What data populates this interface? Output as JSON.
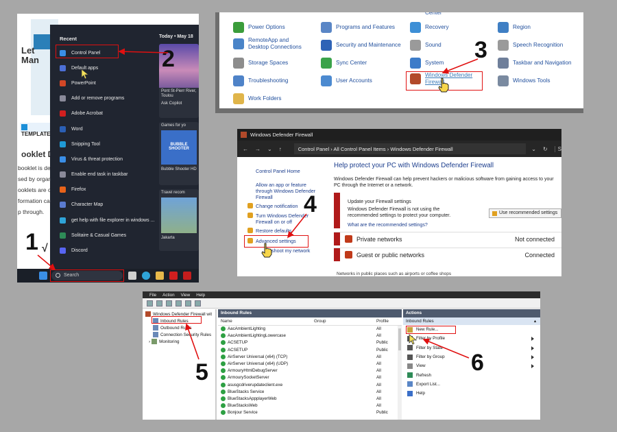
{
  "step_numbers": {
    "s1": "1",
    "s2": "2",
    "s3": "3",
    "s4": "4",
    "s5": "5",
    "s6": "6"
  },
  "start_menu": {
    "doc_title_1": "Let",
    "doc_title_2": "Man",
    "doc_badge": "TEMPLATE.",
    "doc_heading": "ooklet D",
    "doc_lines": [
      "booklet is det",
      "sed by organiz",
      "ooklets are or",
      "formation car",
      "p through."
    ],
    "doc_mark": "√",
    "recent_label": "Recent",
    "items": [
      {
        "label": "Control Panel",
        "icon": "control-panel-icon",
        "color": "#3a8ee6"
      },
      {
        "label": "Default apps",
        "icon": "default-apps-icon",
        "color": "#4c6fd6"
      },
      {
        "label": "PowerPoint",
        "icon": "powerpoint-icon",
        "color": "#d24726"
      },
      {
        "label": "Add or remove programs",
        "icon": "apps-icon",
        "color": "#8a8a9a"
      },
      {
        "label": "Adobe Acrobat",
        "icon": "acrobat-icon",
        "color": "#d11f1f"
      },
      {
        "label": "Word",
        "icon": "word-icon",
        "color": "#2b5fb4"
      },
      {
        "label": "Snipping Tool",
        "icon": "snipping-tool-icon",
        "color": "#1f9ad6"
      },
      {
        "label": "Virus & threat protection",
        "icon": "shield-icon",
        "color": "#3a8ee6"
      },
      {
        "label": "Enable end task in taskbar",
        "icon": "taskbar-icon",
        "color": "#8a8a9a"
      },
      {
        "label": "Firefox",
        "icon": "firefox-icon",
        "color": "#e8631a"
      },
      {
        "label": "Character Map",
        "icon": "character-map-icon",
        "color": "#5a7bd0"
      },
      {
        "label": "get help with file explorer in windows ...",
        "icon": "edge-icon",
        "color": "#2fa4d8"
      },
      {
        "label": "Solitaire & Casual Games",
        "icon": "solitaire-icon",
        "color": "#2e8b57"
      },
      {
        "label": "Discord",
        "icon": "discord-icon",
        "color": "#5865f2"
      }
    ],
    "today_label": "Today • May 18",
    "news_location": "Pont St-Pierr River, Toulou",
    "ask_copilot": "Ask Copilot",
    "games_label": "Games for yo",
    "game_title": "BUBBLE SHOOTER",
    "game_caption": "Bubble Shooter HD",
    "travel_label": "Travel recom",
    "travel_city": "Jakarta",
    "search_placeholder": "Search"
  },
  "control_panel": {
    "partial_top": [
      "Center",
      "Center"
    ],
    "items": [
      {
        "label": "Power Options",
        "icon": "power-options-icon",
        "color": "#3b9d3b"
      },
      {
        "label": "Programs and Features",
        "icon": "programs-icon",
        "color": "#5a86c6"
      },
      {
        "label": "Recovery",
        "icon": "recovery-icon",
        "color": "#3d8fd6"
      },
      {
        "label": "Region",
        "icon": "region-icon",
        "color": "#3f7fc4"
      },
      {
        "label": "RemoteApp and Desktop Connections",
        "icon": "remoteapp-icon",
        "color": "#4a84c8"
      },
      {
        "label": "Security and Maintenance",
        "icon": "flag-icon",
        "color": "#2f63b6"
      },
      {
        "label": "Sound",
        "icon": "sound-icon",
        "color": "#9a9a9a"
      },
      {
        "label": "Speech Recognition",
        "icon": "microphone-icon",
        "color": "#9a9a9a"
      },
      {
        "label": "Storage Spaces",
        "icon": "storage-icon",
        "color": "#8d8d8d"
      },
      {
        "label": "Sync Center",
        "icon": "sync-icon",
        "color": "#3aa34a"
      },
      {
        "label": "System",
        "icon": "system-icon",
        "color": "#3d7cc9"
      },
      {
        "label": "Taskbar and Navigation",
        "icon": "taskbar-nav-icon",
        "color": "#6f7f9a"
      },
      {
        "label": "Troubleshooting",
        "icon": "troubleshooting-icon",
        "color": "#4f83c8"
      },
      {
        "label": "User Accounts",
        "icon": "user-accounts-icon",
        "color": "#4c8ad0"
      },
      {
        "label": "Windows Defender Firewall",
        "icon": "firewall-icon",
        "color": "#b24a2a"
      },
      {
        "label": "Windows Tools",
        "icon": "windows-tools-icon",
        "color": "#7a8aa0"
      },
      {
        "label": "Work Folders",
        "icon": "work-folders-icon",
        "color": "#e0b54a"
      }
    ]
  },
  "firewall": {
    "title": "Windows Defender Firewall",
    "breadcrumb": "Control Panel  ›  All Control Panel Items  ›  Windows Defender Firewall",
    "search_hint": "S",
    "home_link": "Control Panel Home",
    "allow_link": "Allow an app or feature through Windows Defender Firewall",
    "change_link": "Change notification",
    "turn_link": "Turn Windows Defender Firewall on or off",
    "restore_link": "Restore defaults",
    "advanced_link": "Advanced settings",
    "troubleshoot_link": "shoot my network",
    "heading": "Help protect your PC with Windows Defender Firewall",
    "description": "Windows Defender Firewall can help prevent hackers or malicious software from gaining access to your PC through the Internet or a network.",
    "update_title": "Update your Firewall settings",
    "update_text": "Windows Defender Firewall is not using the recommended settings to protect your computer.",
    "recommended_link": "What are the recommended settings?",
    "use_recommended": "Use recommended settings",
    "private_networks": "Private networks",
    "private_status": "Not connected",
    "public_networks": "Guest or public networks",
    "public_status": "Connected",
    "public_desc": "Networks in public places such as airports or coffee shops"
  },
  "advanced": {
    "menu": [
      "File",
      "Action",
      "View",
      "Help"
    ],
    "tree_root": "Windows Defender Firewall wit",
    "tree": [
      "Inbound Rules",
      "Outbound Rules",
      "Connection Security Rules",
      "Monitoring"
    ],
    "panel_title": "Inbound Rules",
    "col_name": "Name",
    "col_group": "Group",
    "col_profile": "Profile",
    "rules": [
      {
        "name": "AacAmbientLighting",
        "profile": "All"
      },
      {
        "name": "AacAmbientLightingLowercase",
        "profile": "All"
      },
      {
        "name": "ACSETUP",
        "profile": "Public"
      },
      {
        "name": "ACSETUP",
        "profile": "Public"
      },
      {
        "name": "AirServer Universal (x64) (TCP)",
        "profile": "All"
      },
      {
        "name": "AirServer Universal (x64) (UDP)",
        "profile": "All"
      },
      {
        "name": "ArmouryHtmlDebugServer",
        "profile": "All"
      },
      {
        "name": "ArmourySocketServer",
        "profile": "All"
      },
      {
        "name": "asusgcdriverupdateclient.exe",
        "profile": "All"
      },
      {
        "name": "BlueStacks Service",
        "profile": "All"
      },
      {
        "name": "BlueStacksAppplayerWeb",
        "profile": "All"
      },
      {
        "name": "BlueStacksWeb",
        "profile": "All"
      },
      {
        "name": "Bonjour Service",
        "profile": "Public"
      }
    ],
    "actions_title": "Actions",
    "actions_sub": "Inbound Rules",
    "actions": [
      {
        "label": "New Rule...",
        "icon": "new-rule-icon",
        "submenu": false
      },
      {
        "label": "Filter by Profile",
        "icon": "filter-icon",
        "submenu": true
      },
      {
        "label": "Filter by State",
        "icon": "filter-icon",
        "submenu": true
      },
      {
        "label": "Filter by Group",
        "icon": "filter-icon",
        "submenu": true
      },
      {
        "label": "View",
        "icon": "view-icon",
        "submenu": true
      },
      {
        "label": "Refresh",
        "icon": "refresh-icon",
        "submenu": false
      },
      {
        "label": "Export List...",
        "icon": "export-icon",
        "submenu": false
      },
      {
        "label": "Help",
        "icon": "help-icon",
        "submenu": false
      }
    ]
  },
  "colors": {
    "highlight": "#e01010",
    "link": "#1a3c8c",
    "start_menu_bg": "#202530"
  }
}
